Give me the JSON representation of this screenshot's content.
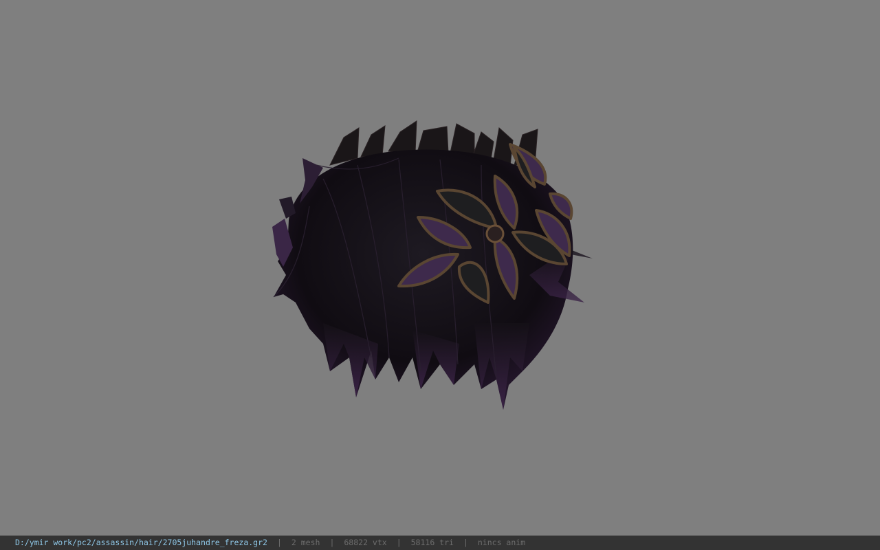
{
  "viewer": {
    "file_path": "D:/ymir work/pc2/assassin/hair/2705juhandre_freza.gr2",
    "mesh_count": "2 mesh",
    "vertex_count": "68822 vtx",
    "triangle_count": "58116 tri",
    "anim_status": "nincs anim",
    "separator": "|"
  },
  "colors": {
    "viewport_background": "#7f7f7f",
    "statusbar_background": "#333333",
    "path_text": "#8fc8e8",
    "info_text": "#6d6d6d",
    "hair": "#120e14",
    "hair_tint": "#3a2640",
    "leaf_purple": "#3e2a4c",
    "leaf_dark": "#1c1c1e",
    "leaf_border": "#5a4632"
  },
  "model": {
    "icon": "hair-model-render"
  }
}
